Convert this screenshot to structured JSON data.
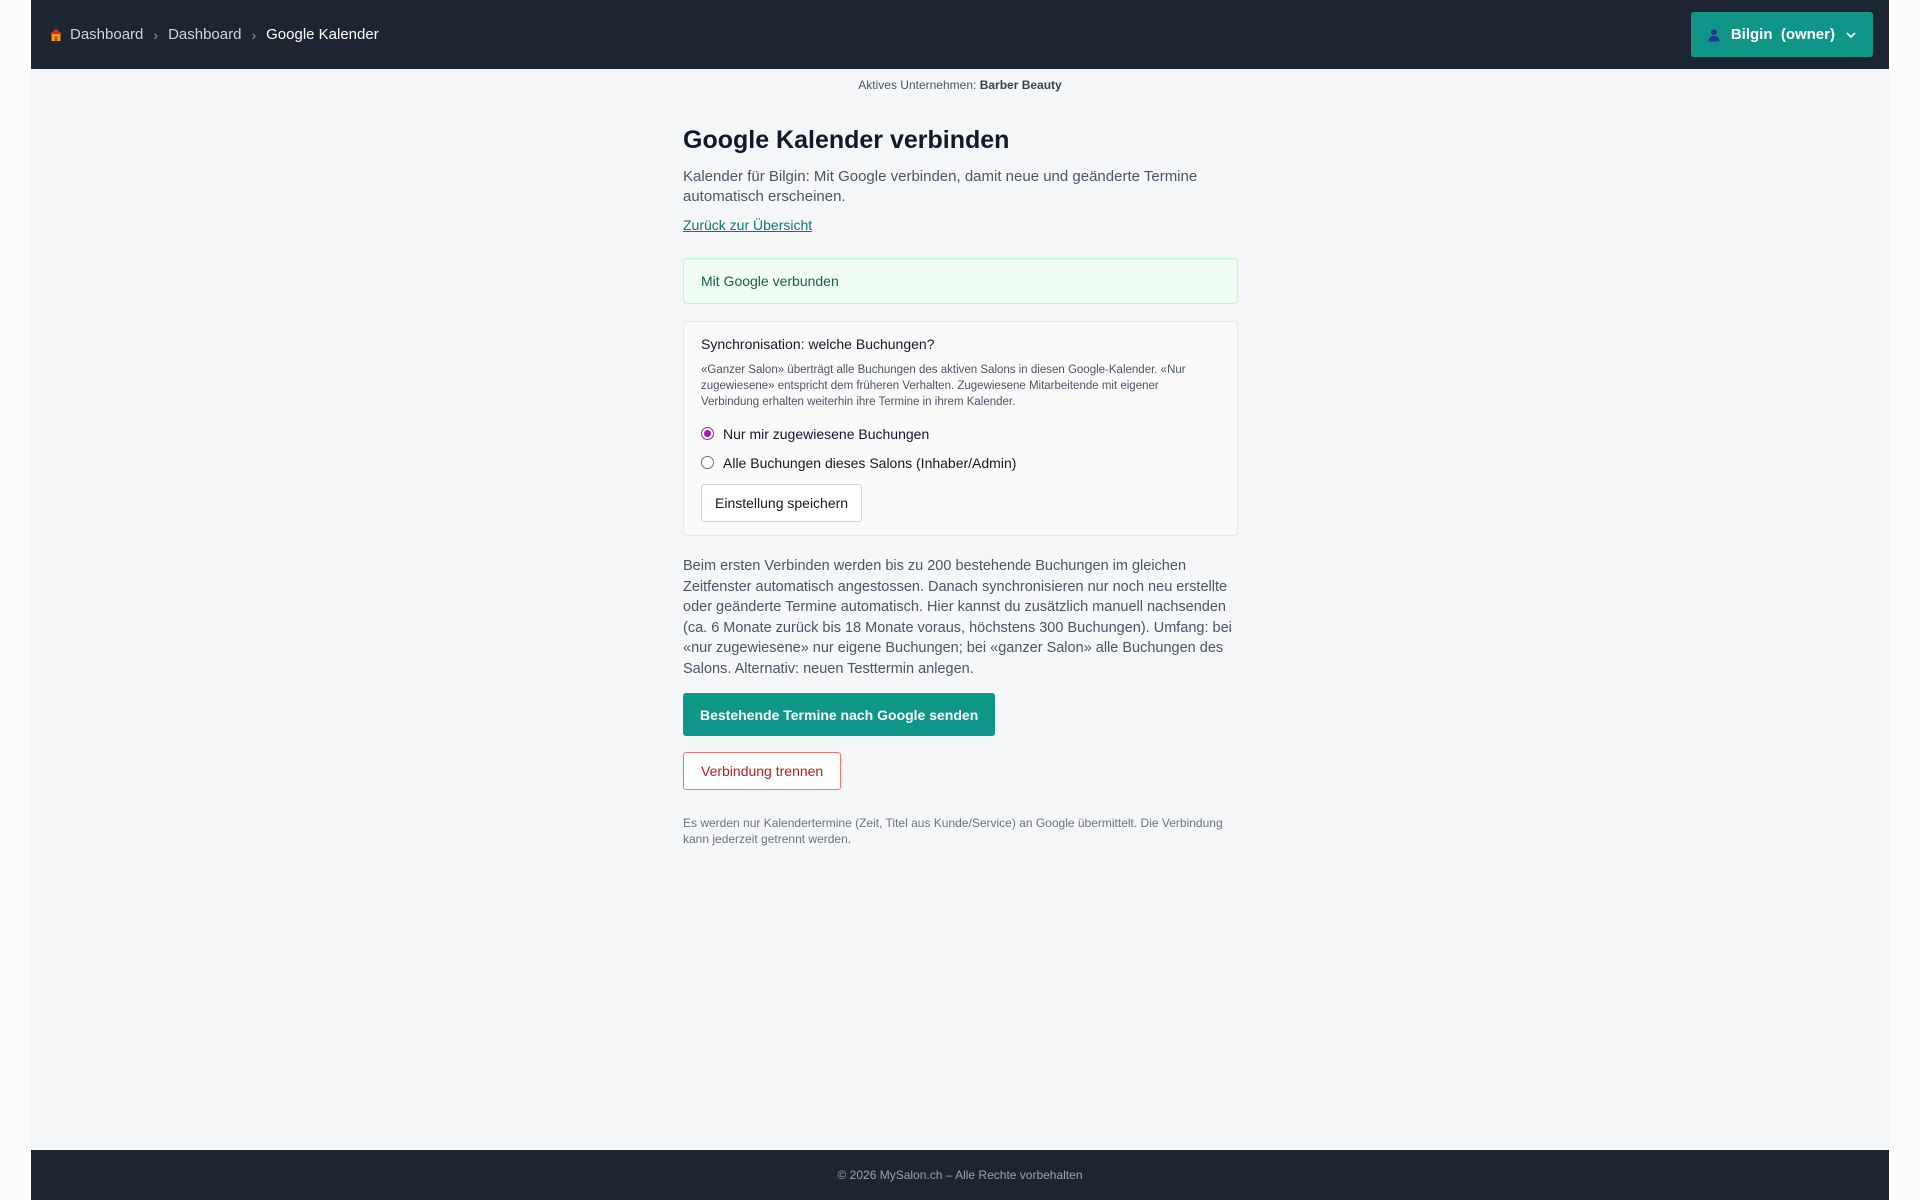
{
  "breadcrumb": {
    "items": [
      "Dashboard",
      "Dashboard"
    ],
    "current": "Google Kalender"
  },
  "user_menu": {
    "label": "Bilgin  (owner)"
  },
  "company": {
    "prefix": "Aktives Unternehmen:",
    "name": "Barber Beauty"
  },
  "page": {
    "title": "Google Kalender verbinden",
    "lead": "Kalender für Bilgin: Mit Google verbinden, damit neue und geänderte Termine automatisch erscheinen.",
    "back_link": "Zurück zur Übersicht",
    "status": "Mit Google verbunden"
  },
  "sync": {
    "title": "Synchronisation: welche Buchungen?",
    "description": "«Ganzer Salon» überträgt alle Buchungen des aktiven Salons in diesen Google-Kalender. «Nur zugewiesene» entspricht dem früheren Verhalten. Zugewiesene Mitarbeitende mit eigener Verbindung erhalten weiterhin ihre Termine in ihrem Kalender.",
    "options": [
      {
        "label": "Nur mir zugewiesene Buchungen",
        "selected": true
      },
      {
        "label": "Alle Buchungen dieses Salons (Inhaber/Admin)",
        "selected": false
      }
    ],
    "save_label": "Einstellung speichern"
  },
  "info": "Beim ersten Verbinden werden bis zu 200 bestehende Buchungen im gleichen Zeitfenster automatisch angestossen. Danach synchronisieren nur noch neu erstellte oder geänderte Termine automatisch. Hier kannst du zusätzlich manuell nachsenden (ca. 6 Monate zurück bis 18 Monate voraus, höchstens 300 Buchungen). Umfang: bei «nur zugewiesene» nur eigene Buchungen; bei «ganzer Salon» alle Buchungen des Salons. Alternativ: neuen Testtermin anlegen.",
  "actions": {
    "push_label": "Bestehende Termine nach Google senden",
    "disconnect_label": "Verbindung trennen"
  },
  "note": "Es werden nur Kalendertermine (Zeit, Titel aus Kunde/Service) an Google übermittelt. Die Verbindung kann jederzeit getrennt werden.",
  "footer": "© 2026 MySalon.ch – Alle Rechte vorbehalten",
  "colors": {
    "accent": "#0f9688",
    "nav": "#1e2532",
    "radio": "#a21caf",
    "danger": "#b91c1c"
  }
}
